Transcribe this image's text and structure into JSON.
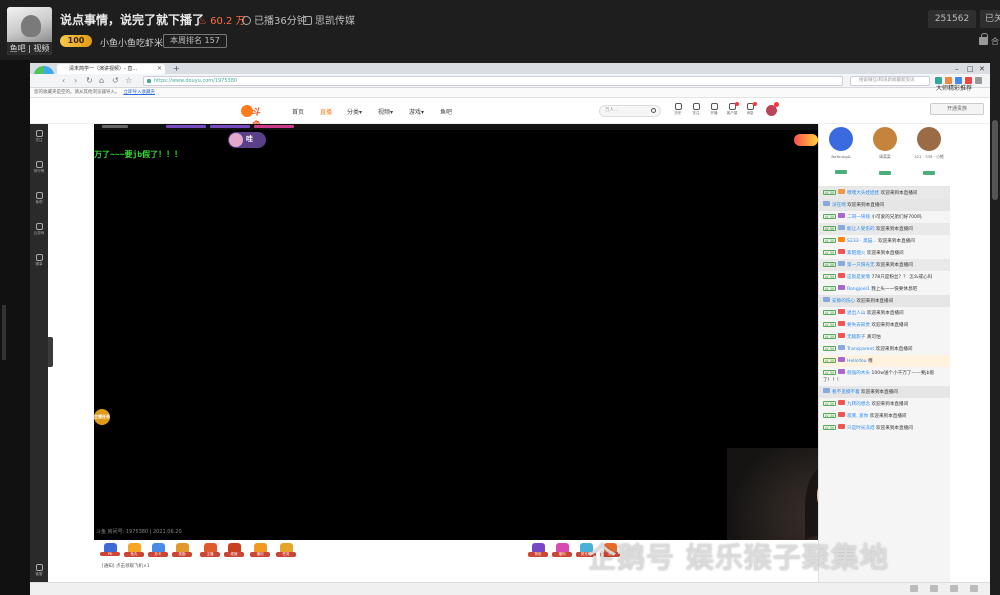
{
  "stream_header": {
    "avatar_caption": "鱼吧 | 视频",
    "title": "说点事情，说完了就下播了",
    "hot_value": "60.2 万",
    "live_duration": "已播36分钟",
    "category": "思凯传媒",
    "fans_badge": "100",
    "anchor_name": "小鱼小鱼吃虾米",
    "weekly_rank": "本周排名 157",
    "room_id": "251562",
    "follow_label": "已关",
    "lock_label": "合"
  },
  "browser": {
    "tab_title": "清末简学一（演讲视频）- 直...",
    "logo_label": "浏览器",
    "url": "https://www.douyu.com/1975380",
    "search_placeholder": "搜索微信/和讯新闻最新资讯",
    "bookmark_text": "您的收藏夹是空的。请从其他浏览器导入。",
    "bookmark_link": "立即导入收藏夹"
  },
  "douyu": {
    "logo": "斗鱼",
    "nav": [
      "首页",
      "直播",
      "分类▾",
      "视频▾",
      "游戏▾",
      "鱼吧"
    ],
    "search_placeholder": "万人...",
    "tools": [
      "历史",
      "关注",
      "开播",
      "客户端",
      "消息"
    ],
    "right_button": "开通贵族",
    "right_sub": "大师精彩推荐"
  },
  "sidebar": {
    "items": [
      "关注",
      "排行榜",
      "鱼吧",
      "云游戏",
      "赛事",
      "客服"
    ]
  },
  "video": {
    "danmu": "万了~~~要jb假了！！！",
    "host_chip": "哇",
    "side_badge": "主播任务",
    "footer": "斗鱼 房间号: 1975380 | 2021.06.20",
    "webcam_watermark": "斗鱼",
    "webcam_room_id": "1975380"
  },
  "gifts": [
    "PK",
    "鱼丸",
    "办卡",
    "奖励",
    "主播",
    "成就",
    "福利",
    "任务",
    "背包",
    "福利",
    "荧光棒",
    "飞机"
  ],
  "notice_text": "[通知] 点击领取飞机×1",
  "chat": {
    "rank_users": [
      {
        "name": "BeYoung&",
        "color": "#3b6ae0"
      },
      {
        "name": "绿菜菜",
        "color": "#c4843b"
      },
      {
        "name": "421 · 339 · 小猪",
        "color": "#9b6b45"
      }
    ],
    "messages": [
      {
        "style": "shaded",
        "level": "LV 30",
        "tag": "#e94",
        "name": "嘿嘿大头娃娃娃",
        "text": "欢迎来到本直播间"
      },
      {
        "style": "enter",
        "level": "",
        "tag": "#8ad",
        "name": "没在啊",
        "text": "欢迎来到本直播间"
      },
      {
        "style": "",
        "level": "LV 30",
        "tag": "#a6c",
        "name": "二哥一块钱",
        "text": "小可爱的兄弟们好700吗"
      },
      {
        "style": "shaded",
        "level": "LV 30",
        "tag": "#8ad",
        "name": "能让人受伤的",
        "text": "欢迎来到本直播间"
      },
      {
        "style": "",
        "level": "LV 30",
        "tag": "#f80",
        "name": "S233 · 黑猫...",
        "text": "欢迎来到本直播间"
      },
      {
        "style": "",
        "level": "LV 30",
        "tag": "#e55",
        "name": "紫陌烟火",
        "text": "欢迎来到本直播间"
      },
      {
        "style": "shaded",
        "level": "LV 30",
        "tag": "#8ad",
        "name": "第一只阳光无",
        "text": "欢迎来到本直播间"
      },
      {
        "style": "",
        "level": "LV 30",
        "tag": "#e55",
        "name": "这就是爱情",
        "text": "778只是粉丝？？ 怎么戒心吗"
      },
      {
        "style": "",
        "level": "LV 30",
        "tag": "#a6c",
        "name": "Rongjoel1",
        "text": "我上头一一快要休息吧"
      },
      {
        "style": "enter",
        "level": "",
        "tag": "#8ad",
        "name": "安静的伤心",
        "text": "欢迎来到本直播间"
      },
      {
        "style": "",
        "level": "LV 30",
        "tag": "#e55",
        "name": "退出人山",
        "text": "欢迎来到本直播间"
      },
      {
        "style": "",
        "level": "LV 30",
        "tag": "#e55",
        "name": "要失去知觉",
        "text": "欢迎来到本直播间"
      },
      {
        "style": "",
        "level": "LV 30",
        "tag": "#e55",
        "name": "无敌影子",
        "text": "真可怕"
      },
      {
        "style": "",
        "level": "LV 30",
        "tag": "#8ad",
        "name": "Transparent",
        "text": "欢迎来到本直播间"
      },
      {
        "style": "vip",
        "level": "LV 30",
        "tag": "#a6c",
        "name": "HelloYou",
        "text": "哦"
      },
      {
        "style": "",
        "level": "LV 30",
        "tag": "#a6c",
        "name": "倔强的木头",
        "text": "100w送个小千万了——要jb假了！！！"
      },
      {
        "style": "enter",
        "level": "",
        "tag": "#8ad",
        "name": "看不见摸不着",
        "text": "欢迎来到本直播间"
      },
      {
        "style": "",
        "level": "LV 30",
        "tag": "#e55",
        "name": "九转的想念",
        "text": "欢迎来到本直播间"
      },
      {
        "style": "",
        "level": "LV 30",
        "tag": "#e55",
        "name": "寂寞, 爱你",
        "text": "欢迎来到本直播间"
      },
      {
        "style": "",
        "level": "LV 30",
        "tag": "#e55",
        "name": "只是时光冻结",
        "text": "欢迎来到本直播间"
      }
    ]
  },
  "watermark": "企鹅号  娱乐猴子聚集地",
  "colors": {
    "douyu_orange": "#ff7a1a",
    "chat_name_blue": "#2d8cf0",
    "danmu_green": "#33dd33"
  }
}
